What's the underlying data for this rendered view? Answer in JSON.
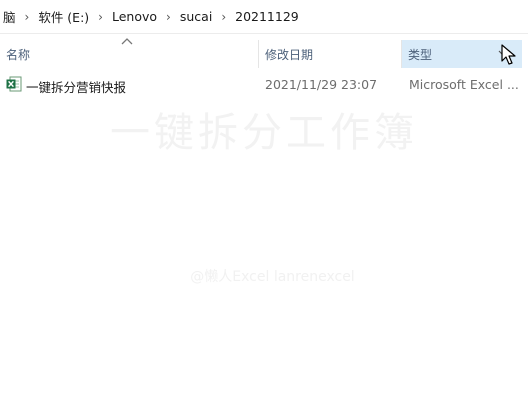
{
  "breadcrumb": {
    "items": [
      "脑",
      "软件 (E:)",
      "Lenovo",
      "sucai",
      "20211129"
    ],
    "separator": "›"
  },
  "columns": {
    "name": "名称",
    "date_modified": "修改日期",
    "type": "类型"
  },
  "files": [
    {
      "name": "一键拆分营销快报",
      "date_modified": "2021/11/29 23:07",
      "type": "Microsoft Excel ...",
      "icon": "excel-file-icon"
    }
  ],
  "watermark": {
    "title": "一键拆分工作簿",
    "subtitle": "@懒人Excel  lanrenexcel"
  },
  "colors": {
    "header_text": "#4c607a",
    "type_header_highlight": "#d9ebf9",
    "excel_green": "#1e7145"
  }
}
